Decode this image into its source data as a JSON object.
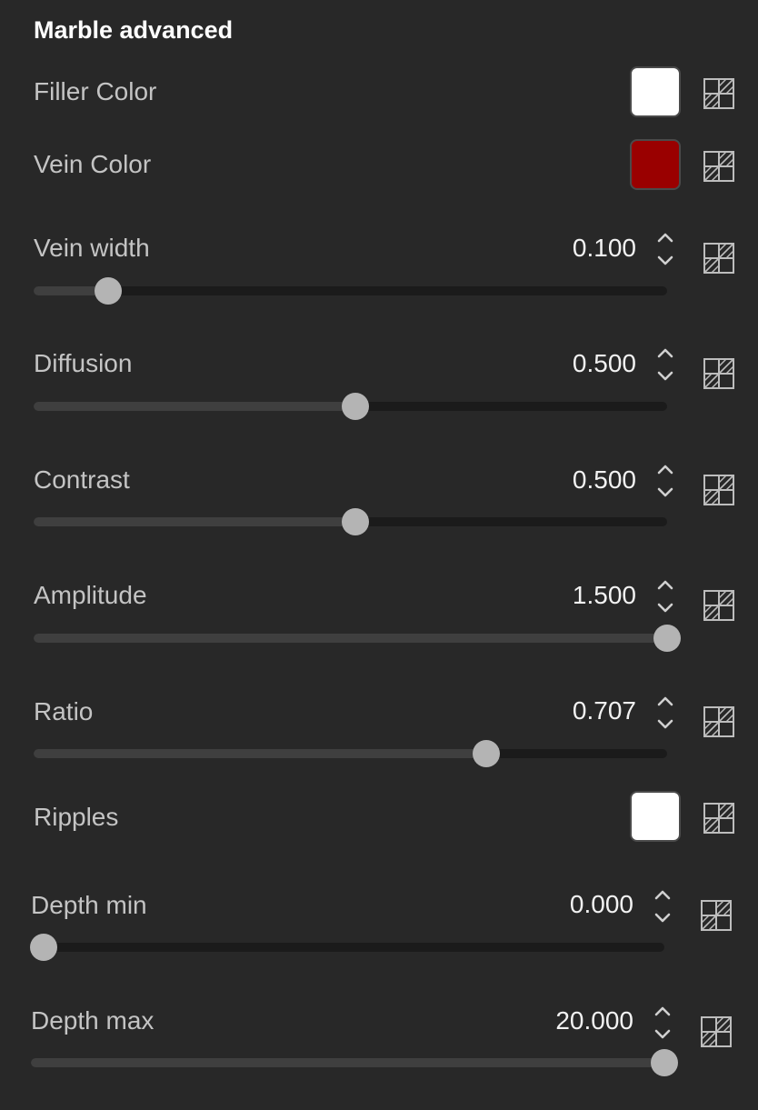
{
  "panel": {
    "title": "Marble advanced"
  },
  "colors": {
    "background": "#282828",
    "track": "#1b1b1b",
    "fill": "#3f3f3f",
    "thumb": "#b4b4b4",
    "link_icon": "#bdbdbd",
    "chevron": "#d0d0d0"
  },
  "color_params": [
    {
      "id": "filler-color",
      "label": "Filler Color",
      "color": "#ffffff"
    },
    {
      "id": "vein-color",
      "label": "Vein Color",
      "color": "#9a0000"
    },
    {
      "id": "ripples",
      "label": "Ripples",
      "color": "#ffffff"
    }
  ],
  "sliders": [
    {
      "id": "vein-width",
      "label": "Vein width",
      "value": "0.100",
      "fraction": 0.118
    },
    {
      "id": "diffusion",
      "label": "Diffusion",
      "value": "0.500",
      "fraction": 0.508
    },
    {
      "id": "contrast",
      "label": "Contrast",
      "value": "0.500",
      "fraction": 0.508
    },
    {
      "id": "amplitude",
      "label": "Amplitude",
      "value": "1.500",
      "fraction": 1.0
    },
    {
      "id": "ratio",
      "label": "Ratio",
      "value": "0.707",
      "fraction": 0.714
    },
    {
      "id": "depth-min",
      "label": "Depth min",
      "value": "0.000",
      "fraction": 0.02
    },
    {
      "id": "depth-max",
      "label": "Depth max",
      "value": "20.000",
      "fraction": 1.0
    }
  ],
  "icons": {
    "stepper_up": "chevron-up-icon",
    "stepper_down": "chevron-down-icon",
    "link": "texture-link-icon"
  }
}
